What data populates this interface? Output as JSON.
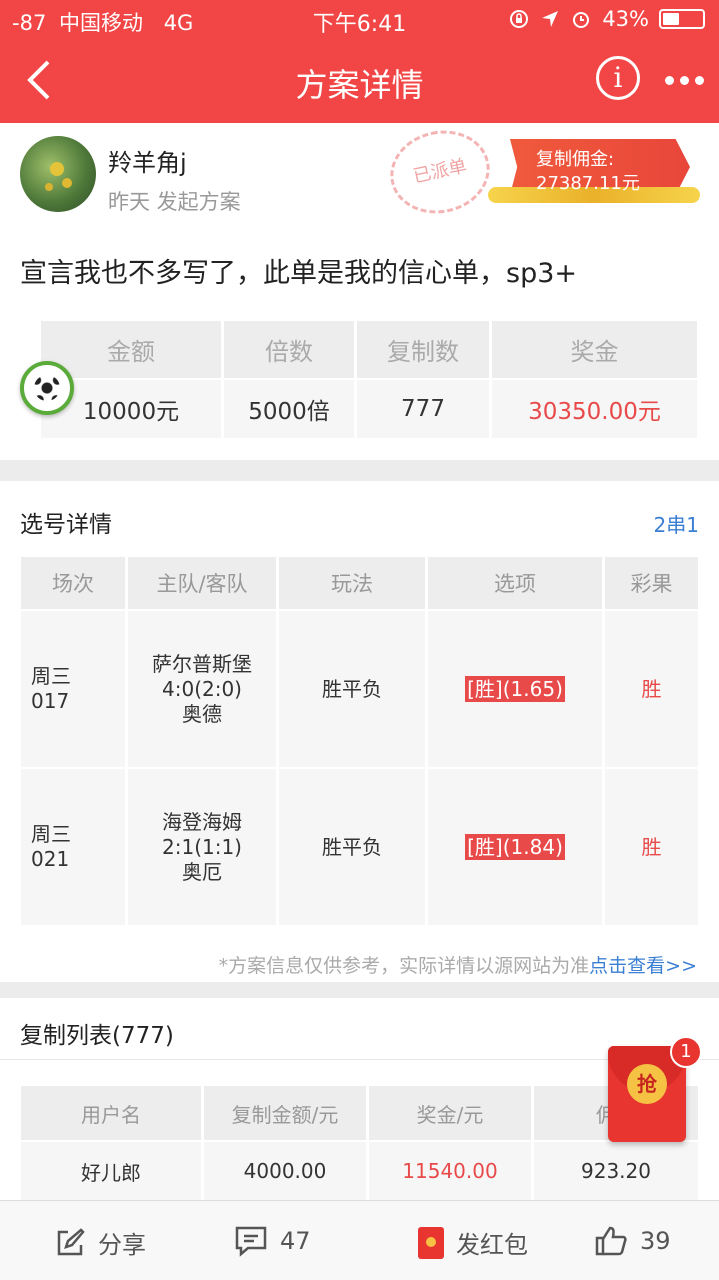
{
  "status_bar": {
    "signal": "-87",
    "carrier": "中国移动",
    "network": "4G",
    "time": "下午6:41",
    "battery": "43%",
    "battery_level": 0.43
  },
  "nav": {
    "title": "方案详情",
    "back_icon": "chevron-left-icon",
    "info_icon": "info-icon",
    "more_icon": "more-dots-icon"
  },
  "author": {
    "name": "羚羊角j",
    "time": "昨天 发起方案",
    "stamp": "已派单",
    "commission_label": "复制佣金:",
    "commission_value": "27387.11元"
  },
  "declaration": "宣言我也不多写了，此单是我的信心单，sp3+",
  "summary": {
    "headers": [
      "金额",
      "倍数",
      "复制数",
      "奖金"
    ],
    "values": [
      "10000元",
      "5000倍",
      "777",
      "30350.00元"
    ]
  },
  "selection": {
    "title": "选号详情",
    "serial": "2串1",
    "headers": [
      "场次",
      "主队/客队",
      "玩法",
      "选项",
      "彩果"
    ],
    "rows": [
      {
        "day": "周三",
        "num": "017",
        "home": "萨尔普斯堡",
        "score": "4:0(2:0)",
        "away": "奥德",
        "play": "胜平负",
        "pick": "[胜](1.65)",
        "result": "胜"
      },
      {
        "day": "周三",
        "num": "021",
        "home": "海登海姆",
        "score": "2:1(1:1)",
        "away": "奥厄",
        "play": "胜平负",
        "pick": "[胜](1.84)",
        "result": "胜"
      }
    ],
    "disclaimer": "*方案信息仅供参考，实际详情以源网站为准",
    "disclaimer_link": "点击查看>>"
  },
  "copy_list": {
    "title": "复制列表(777)",
    "headers": [
      "用户名",
      "复制金额/元",
      "奖金/元",
      "佣金"
    ],
    "rows": [
      {
        "user": "好儿郎",
        "amount": "4000.00",
        "prize": "11540.00",
        "commission": "923.20"
      }
    ]
  },
  "red_packet": {
    "label": "抢",
    "badge": "1"
  },
  "bottom_bar": {
    "share": "分享",
    "comments": "47",
    "red_packet": "发红包",
    "likes": "39"
  },
  "colors": {
    "brand": "#f24646",
    "link": "#3b7fd4",
    "prize": "#e84a4a"
  }
}
